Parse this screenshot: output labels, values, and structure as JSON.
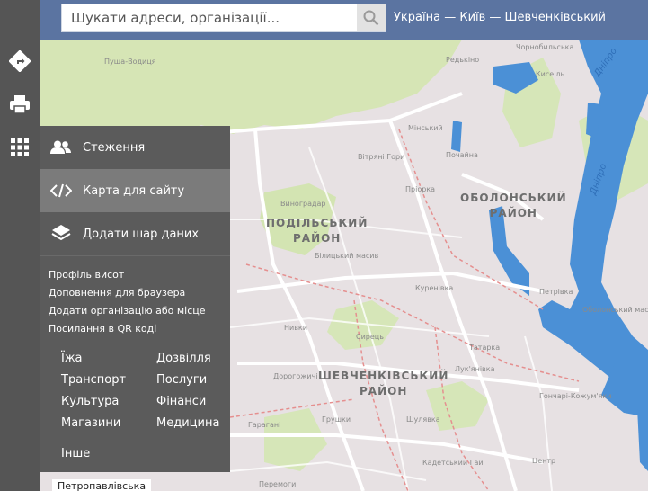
{
  "search": {
    "placeholder": "Шукати адреси, організації..."
  },
  "breadcrumb": "Україна — Київ — Шевченківський",
  "toolbar": {
    "items": [
      {
        "icon": "directions-icon"
      },
      {
        "icon": "print-icon"
      },
      {
        "icon": "apps-grid-icon"
      }
    ]
  },
  "menu": {
    "items": [
      {
        "label": "Стеження",
        "icon": "users-icon"
      },
      {
        "label": "Карта для сайту",
        "icon": "code-icon",
        "active": true
      },
      {
        "label": "Додати шар даних",
        "icon": "layers-icon"
      }
    ],
    "links": [
      "Профіль висот",
      "Доповнення для браузера",
      "Додати організацію або місце",
      "Посилання в QR коді"
    ],
    "categories": [
      "Їжа",
      "Дозвілля",
      "Транспорт",
      "Послуги",
      "Культура",
      "Фінанси",
      "Магазини",
      "Медицина",
      "Інше"
    ]
  },
  "map": {
    "districts": [
      {
        "line1": "ПОДІЛЬСЬКИЙ",
        "line2": "РАЙОН"
      },
      {
        "line1": "ОБОЛОНСЬКИЙ",
        "line2": "РАЙОН"
      },
      {
        "line1": "ШЕВЧЕНКІВСЬКИЙ",
        "line2": "РАЙОН"
      }
    ],
    "places": [
      "Пуща-Водиця",
      "Мінський",
      "Вітряні Гори",
      "Пріорка",
      "Виноградар",
      "Білицький масив",
      "Куренівка",
      "Петрівка",
      "Сирець",
      "Нивки",
      "Татарка",
      "Дорогожичі",
      "Лук'янівка",
      "Гончарі-Кожум'яки",
      "Грушки",
      "Шулявка",
      "Гарагані",
      "Кадетський Гай",
      "Чорнобильська",
      "Редькіно",
      "Кисеіль",
      "Оболонський масив",
      "Почайна",
      "Центр",
      "Перемоги"
    ],
    "rivers": [
      "Дніпро",
      "Дніпро"
    ],
    "colors": {
      "water": "#4b90d6",
      "park": "#d7e6b7",
      "urban": "#e3dcdf",
      "road_major": "#ffffff",
      "district_border": "#e58f8f"
    },
    "street_label": "Петропавлівська"
  }
}
